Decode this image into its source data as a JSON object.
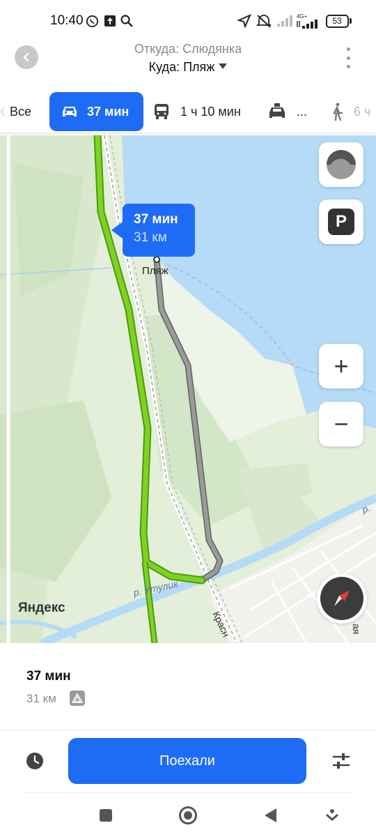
{
  "status": {
    "time": "10:40",
    "battery": "53",
    "network": "4G+"
  },
  "header": {
    "from": "Откуда: Слюдянка",
    "to": "Куда: Пляж"
  },
  "tabs": [
    {
      "label": "Все",
      "icon": "all-icon"
    },
    {
      "label": "37 мин",
      "icon": "car-icon",
      "active": true
    },
    {
      "label": "1 ч 10 мин",
      "icon": "bus-icon"
    },
    {
      "label": "...",
      "icon": "taxi-icon"
    },
    {
      "label": "6 ч",
      "icon": "walk-icon"
    }
  ],
  "map": {
    "bubble_time": "37 мин",
    "bubble_distance": "31 км",
    "destination_label": "Пляж",
    "river_label": "р. Утулик",
    "river_label_2": "р.",
    "street_label": "Красн",
    "street_label_2": "ая",
    "logo": "Яндекс",
    "parking_label": "P",
    "zoom_in": "+",
    "zoom_out": "−"
  },
  "summary": {
    "time": "37 мин",
    "distance": "31 км"
  },
  "actions": {
    "go_label": "Поехали"
  },
  "colors": {
    "accent": "#1e6cf6",
    "route_green": "#7ed321",
    "route_gray": "#8c8c8c",
    "water": "#b5dbf7",
    "land": "#e3efd9"
  }
}
